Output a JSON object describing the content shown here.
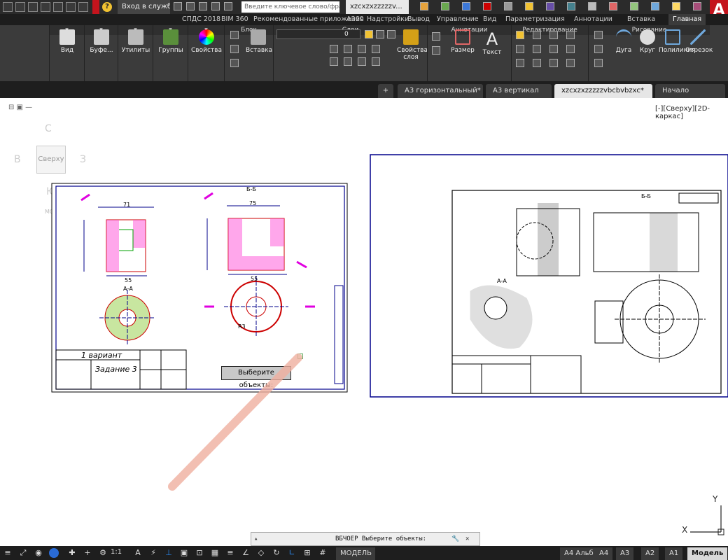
{
  "titlebar": {
    "doc_tabs": [
      "xzcxzxzzzzzv...",
      "Введите ключевое слово/фразу",
      "Вход в службы",
      "?"
    ],
    "search_placeholder": "Введите ключевое слово/фразу",
    "signin": "Вход в службы",
    "logo": "A"
  },
  "ribbon_tabs": [
    "СПДС 2018",
    "BIM 360",
    "Рекомендованные приложения",
    "A360",
    "Надстройки",
    "Вывод",
    "Управление",
    "Вид",
    "Параметризация",
    "Аннотации",
    "Вставка",
    "Главная"
  ],
  "panels": {
    "draw": {
      "title": "Рисование",
      "polyline": "Полилиния",
      "circle": "Круг",
      "arc": "Дуга",
      "line": "Отрезок"
    },
    "modify": {
      "title": "Редактирование"
    },
    "annotation": {
      "title": "Аннотации",
      "text": "Текст",
      "dimension": "Размер"
    },
    "layers": {
      "title": "Слои",
      "properties": "Свойства слоя",
      "current_layer": "0"
    },
    "block": {
      "title": "Блок",
      "insert": "Вставка"
    },
    "properties": {
      "label": "Свойства"
    },
    "groups": {
      "label": "Группы"
    },
    "utilities": {
      "label": "Утилиты"
    },
    "clipboard": {
      "label": "Буфе..."
    },
    "view": {
      "label": "Вид"
    }
  },
  "file_tabs": [
    "Начало",
    "xzcxzxzzzzzvbcbvbzxc*",
    "А3 вертикал",
    "А3 горизонтальный*",
    "+"
  ],
  "view_label": "[-][Сверху][2D-каркас]",
  "viewcube": {
    "top": "Сверху",
    "n": "С",
    "w": "В",
    "e": "З",
    "s": "Ю",
    "ucs": "МСК"
  },
  "tooltip": "Выберите объекты:",
  "command_line": "ВБЧОЕР Выберите объекты:",
  "status": {
    "layouts": [
      "Модель",
      "A1",
      "A2",
      "A3",
      "A4",
      "A4 Альб"
    ],
    "model": "МОДЕЛЬ",
    "scale": "1:1"
  },
  "ucs_axes": {
    "x": "X",
    "y": "Y"
  },
  "drawing_text": {
    "s1": "Б-Б",
    "s2": "А-А",
    "d1": "71",
    "d2": "75",
    "d3": "55",
    "d4": "55",
    "title1": "1 вариант",
    "title2": "Задание 3",
    "r1": "R3",
    "s3": "А-А",
    "s4": "Б-Б"
  }
}
